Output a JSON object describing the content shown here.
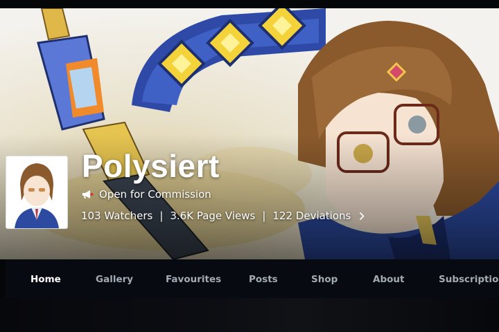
{
  "profile": {
    "username": "Polysiert",
    "commission_status": "Open for Commission",
    "stats": {
      "watchers": "103 Watchers",
      "page_views": "3.6K Page Views",
      "deviations": "122 Deviations",
      "separator": "|"
    },
    "chevron_icon": "chevron-right-icon",
    "megaphone_icon": "megaphone-icon"
  },
  "nav": {
    "items": [
      "Home",
      "Gallery",
      "Favourites",
      "Posts",
      "Shop",
      "About",
      "Subscriptions"
    ],
    "active": "Home"
  },
  "colors": {
    "nav_bg": "#070a11",
    "nav_text": "#a3abb3",
    "nav_active": "#ffffff",
    "title": "#ffffff"
  }
}
